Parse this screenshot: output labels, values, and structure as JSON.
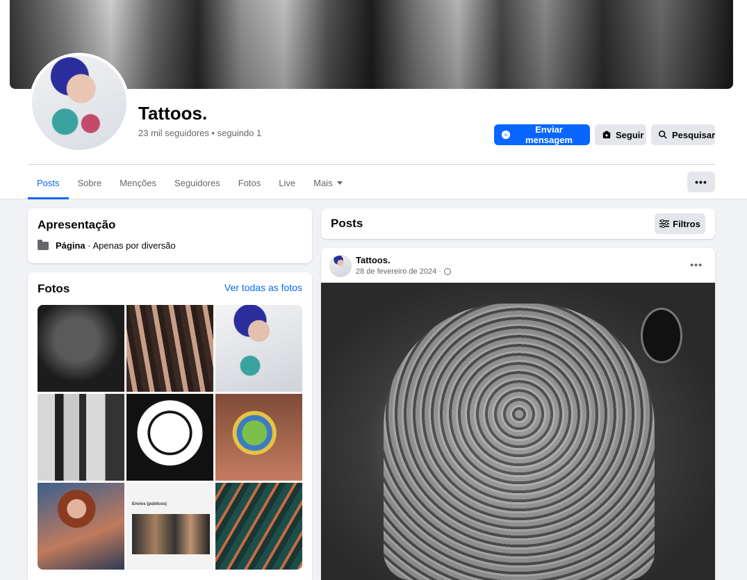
{
  "page": {
    "name": "Tattoos.",
    "stats": "23 mil seguidores • seguindo 1"
  },
  "actions": {
    "message": "Enviar mensagem",
    "follow": "Seguir",
    "search": "Pesquisar"
  },
  "tabs": [
    "Posts",
    "Sobre",
    "Menções",
    "Seguidores",
    "Fotos",
    "Live",
    "Mais"
  ],
  "more_menu": "•••",
  "intro": {
    "title": "Apresentação",
    "category_label": "Página",
    "category_value": " · Apenas por diversão"
  },
  "photos": {
    "title": "Fotos",
    "see_all": "Ver todas as fotos",
    "thumb8_caption": "Envios (públicos)"
  },
  "posts_header": {
    "title": "Posts",
    "filter": "Filtros"
  },
  "post": {
    "author": "Tattoos.",
    "date": "28 de fevereiro de 2024 ·",
    "menu": "•••"
  },
  "colors": {
    "accent": "#0866ff",
    "background": "#f0f2f5",
    "button_gray": "#e4e6eb"
  }
}
